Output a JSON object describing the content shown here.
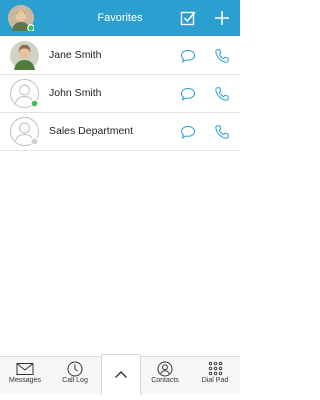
{
  "header": {
    "title": "Favorites",
    "status_color": "#34c759",
    "accent": "#2a9fd0",
    "icons": [
      "user-avatar",
      "select-checkbox-icon",
      "add-icon"
    ]
  },
  "contacts": [
    {
      "name": "Jane Smith",
      "photo": true,
      "status": "none"
    },
    {
      "name": "John Smith",
      "photo": false,
      "status": "online"
    },
    {
      "name": "Sales Department",
      "photo": false,
      "status": "offline"
    }
  ],
  "footer": {
    "tabs": [
      {
        "label": "Messages",
        "icon": "envelope-icon"
      },
      {
        "label": "Call Log",
        "icon": "clock-icon"
      },
      {
        "label": "",
        "icon": "chevron-up-icon"
      },
      {
        "label": "Contacts",
        "icon": "contact-icon"
      },
      {
        "label": "Dial Pad",
        "icon": "dialpad-icon"
      }
    ]
  }
}
